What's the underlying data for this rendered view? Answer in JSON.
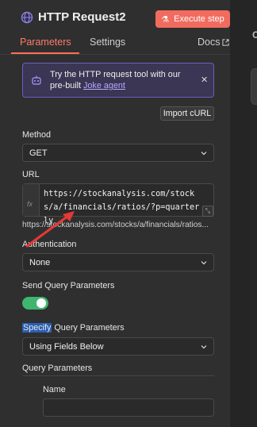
{
  "header": {
    "title": "HTTP Request2",
    "execute_label": "Execute step"
  },
  "tabs": {
    "parameters": "Parameters",
    "settings": "Settings",
    "docs": "Docs"
  },
  "banner": {
    "text": "Try the HTTP request tool with our pre-built",
    "link": "Joke agent"
  },
  "import_curl_label": "Import cURL",
  "method": {
    "label": "Method",
    "value": "GET"
  },
  "url": {
    "label": "URL",
    "value": "https://stockanalysis.com/stocks/a/financials/ratios/?p=quarterly",
    "preview": "https://stockanalysis.com/stocks/a/financials/ratios..."
  },
  "authentication": {
    "label": "Authentication",
    "value": "None"
  },
  "send_query": {
    "label": "Send Query Parameters",
    "enabled": true
  },
  "specify_query": {
    "label_highlight": "Specify",
    "label_rest": " Query Parameters",
    "value": "Using Fields Below"
  },
  "query_parameters": {
    "label": "Query Parameters",
    "name_label": "Name",
    "name_value": ""
  },
  "colors": {
    "accent": "#ff6d5a",
    "toggle_on": "#3fb56f",
    "banner_border": "#6a5fc1",
    "annotation_arrow": "#e53935"
  },
  "right_panel": {
    "top_letter": "O"
  }
}
